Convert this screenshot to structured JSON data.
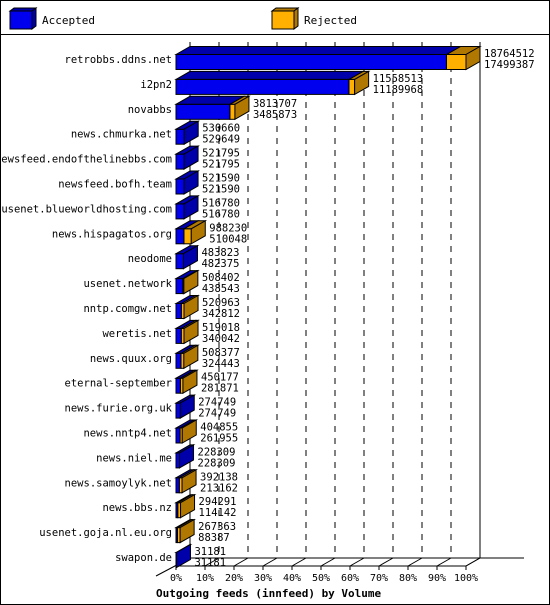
{
  "chart_data": {
    "type": "bar",
    "orientation": "horizontal",
    "title": "Outgoing feeds (innfeed) by Volume",
    "xlabel": "",
    "ylabel": "",
    "xlim": [
      0,
      100
    ],
    "x_ticks": [
      "0%",
      "10%",
      "20%",
      "30%",
      "40%",
      "50%",
      "60%",
      "70%",
      "80%",
      "90%",
      "100%"
    ],
    "grid": true,
    "legend_position": "top",
    "stacked": true,
    "series": [
      {
        "name": "Accepted",
        "color": "#0000ee"
      },
      {
        "name": "Rejected",
        "color": "#ffb000"
      }
    ],
    "categories": [
      "retrobbs.ddns.net",
      "i2pn2",
      "novabbs",
      "news.chmurka.net",
      "newsfeed.endofthelinebbs.com",
      "newsfeed.bofh.team",
      "usenet.blueworldhosting.com",
      "news.hispagatos.org",
      "neodome",
      "usenet.network",
      "nntp.comgw.net",
      "weretis.net",
      "news.quux.org",
      "eternal-september",
      "news.furie.org.uk",
      "news.nntp4.net",
      "news.niel.me",
      "news.samoylyk.net",
      "news.bbs.nz",
      "usenet.goja.nl.eu.org",
      "swapon.de"
    ],
    "offered": [
      18764512,
      11558513,
      3813707,
      530660,
      521795,
      521590,
      516780,
      988230,
      483823,
      508402,
      520963,
      519018,
      508377,
      450177,
      274749,
      404855,
      228309,
      392138,
      294291,
      267363,
      31181
    ],
    "accepted": [
      17499387,
      11189968,
      3485873,
      529649,
      521795,
      521590,
      516780,
      510048,
      482375,
      438543,
      342812,
      340042,
      324443,
      281871,
      274749,
      261955,
      228309,
      213162,
      114142,
      88387,
      31181
    ],
    "bar_segments_note": "front bar length = offered relative to max; blue part = share accepted of bar, orange = rejected, as drawn"
  },
  "legend": {
    "accepted_label": "Accepted",
    "rejected_label": "Rejected"
  }
}
